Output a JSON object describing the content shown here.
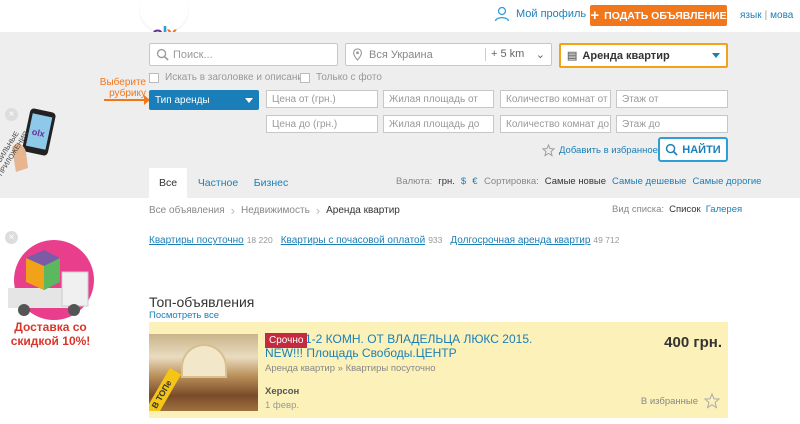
{
  "header": {
    "logo": "OLX",
    "profile_label": "Мой профиль",
    "post_button": "ПОДАТЬ ОБЪЯВЛЕНИЕ",
    "lang_ru": "язык",
    "lang_ua": "мова"
  },
  "search": {
    "query_placeholder": "Поиск...",
    "location_value": "Вся Украина",
    "radius_value": "+ 5 km",
    "category_value": "Аренда квартир",
    "check_title_desc": "Искать в заголовке и описании",
    "check_photo_only": "Только с фото",
    "hint_text": "Выберите рубрику",
    "rent_type_label": "Тип аренды",
    "filters": {
      "price_from": "Цена от (грн.)",
      "price_to": "Цена до (грн.)",
      "area_from": "Жилая площадь от",
      "area_to": "Жилая площадь до",
      "rooms_from": "Количество комнат от",
      "rooms_to": "Количество комнат до",
      "floor_from": "Этаж от",
      "floor_to": "Этаж до"
    },
    "add_favorites": "Добавить в избранное",
    "find_button": "НАЙТИ"
  },
  "tabs": {
    "all": "Все",
    "private": "Частное",
    "business": "Бизнес"
  },
  "currency": {
    "label": "Валюта:",
    "uah": "грн.",
    "usd": "$",
    "eur": "€"
  },
  "sorting": {
    "label": "Сортировка:",
    "newest": "Самые новые",
    "cheapest": "Самые дешевые",
    "expensive": "Самые дорогие"
  },
  "breadcrumb": {
    "all": "Все объявления",
    "realty": "Недвижимость",
    "current": "Аренда квартир"
  },
  "view": {
    "label": "Вид списка:",
    "list": "Список",
    "gallery": "Галерея"
  },
  "subcategories": [
    {
      "label": "Квартиры посуточно",
      "count": "18 220"
    },
    {
      "label": "Квартиры с почасовой оплатой",
      "count": "933"
    },
    {
      "label": "Долгосрочная аренда квартир",
      "count": "49 712"
    }
  ],
  "top_ads": {
    "title": "Топ-объявления",
    "show_all": "Посмотреть все",
    "ads": [
      {
        "badge": "Срочно",
        "title": "1-2 КОМН. ОТ ВЛАДЕЛЬЦА ЛЮКС 2015. NEW!!! Площадь Свободы.ЦЕНТР",
        "category": "Аренда квартир » Квартиры посуточно",
        "city": "Херсон",
        "date": "1 февр.",
        "price": "400 грн.",
        "favorite": "В избранные",
        "ribbon": "В ТОПе"
      }
    ]
  },
  "promos": {
    "mobile_label": "МОБИЛЬНЫЕ ПРИЛОЖЕНИЯ",
    "delivery_text": "Доставка со скидкой 10%!"
  },
  "colors": {
    "accent_orange": "#f2761a",
    "link_blue": "#1a7fb8",
    "ad_bg": "#fbf1b9",
    "urgent_red": "#c32a3f"
  }
}
